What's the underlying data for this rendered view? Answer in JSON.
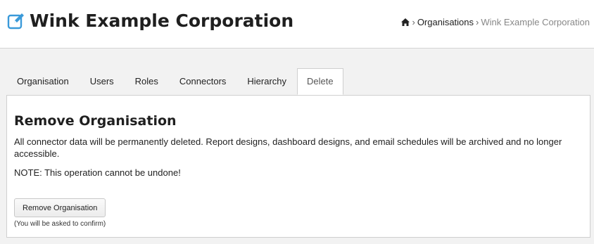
{
  "header": {
    "title": "Wink Example Corporation",
    "title_icon": "edit-icon",
    "accent_color": "#3a9ad9"
  },
  "breadcrumb": {
    "home_icon": "home-icon",
    "items": [
      "Organisations",
      "Wink Example Corporation"
    ]
  },
  "tabs": [
    {
      "label": "Organisation",
      "active": false
    },
    {
      "label": "Users",
      "active": false
    },
    {
      "label": "Roles",
      "active": false
    },
    {
      "label": "Connectors",
      "active": false
    },
    {
      "label": "Hierarchy",
      "active": false
    },
    {
      "label": "Delete",
      "active": true
    }
  ],
  "panel": {
    "title": "Remove Organisation",
    "description": "All connector data will be permanently deleted. Report designs, dashboard designs, and email schedules will be archived and no longer accessible.",
    "note": "NOTE: This operation cannot be undone!",
    "button_label": "Remove Organisation",
    "hint": "(You will be asked to confirm)"
  }
}
